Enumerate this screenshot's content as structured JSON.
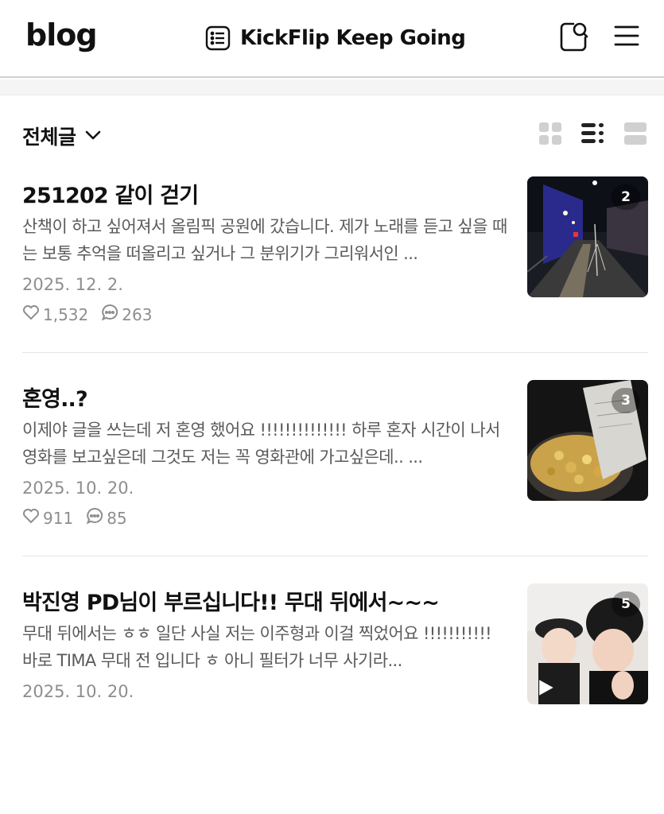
{
  "header": {
    "logo": "blog",
    "blog_title": "KickFlip Keep Going"
  },
  "filter": {
    "label": "전체글"
  },
  "posts": [
    {
      "title": "251202 같이 걷기",
      "excerpt": "산책이 하고 싶어져서 올림픽 공원에 갔습니다. 제가 노래를 듣고 싶을 때는 보통 추억을 떠올리고 싶거나 그 분위기가 그리워서인 ...",
      "date": "2025. 12. 2.",
      "likes": "1,532",
      "comments": "263",
      "image_count": "2"
    },
    {
      "title": "혼영..?",
      "excerpt": "이제야 글을 쓰는데 저 혼영 했어요 !!!!!!!!!!!!!! 하루 혼자 시간이 나서 영화를 보고싶은데 그것도 저는 꼭 영화관에 가고싶은데.. ...",
      "date": "2025. 10. 20.",
      "likes": "911",
      "comments": "85",
      "image_count": "3"
    },
    {
      "title": "박진영 PD님이 부르십니다!! 무대 뒤에서~~~",
      "excerpt": "무대 뒤에서는 ㅎㅎ 일단 사실 저는 이주형과 이걸 찍었어요 !!!!!!!!!!! 바로 TIMA 무대 전 입니다 ㅎ 아니 필터가 너무 사기라...",
      "date": "2025. 10. 20.",
      "image_count": "5"
    }
  ],
  "icons": {
    "header": [
      "list-icon",
      "search-icon",
      "menu-icon"
    ],
    "filter": [
      "chevron-down-icon",
      "grid-view-icon",
      "list-view-icon",
      "card-view-icon"
    ],
    "stats": [
      "heart-icon",
      "comment-icon"
    ],
    "media": [
      "play-icon"
    ]
  },
  "colors": {
    "text": "#111111",
    "excerpt": "#5a5a5a",
    "meta": "#8e8e8e",
    "divider": "#e4e4e4"
  }
}
